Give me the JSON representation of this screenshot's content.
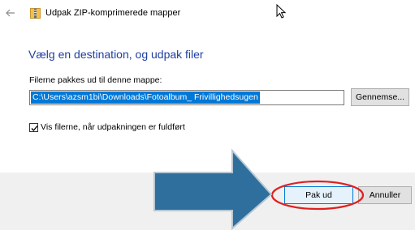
{
  "window": {
    "title": "Udpak ZIP-komprimerede mapper"
  },
  "heading": "Vælg en destination, og udpak filer",
  "destination": {
    "label": "Filerne pakkes ud til denne mappe:",
    "value": "C:\\Users\\azsm1bi\\Downloads\\Fotoalbum_ Frivillighedsugen",
    "browse_label": "Gennemse..."
  },
  "show_files": {
    "label": "Vis filerne, når udpakningen er fuldført",
    "checked": true
  },
  "footer": {
    "extract_label": "Pak ud",
    "cancel_label": "Annuller"
  },
  "colors": {
    "heading": "#1f3f9f",
    "selection": "#0078d7",
    "annotation_arrow": "#2e6f9e",
    "annotation_ellipse": "#e02020"
  },
  "icons": {
    "back": "back-arrow-icon",
    "zip": "zip-folder-icon",
    "cursor": "mouse-cursor-icon",
    "check": "checkmark-icon"
  }
}
